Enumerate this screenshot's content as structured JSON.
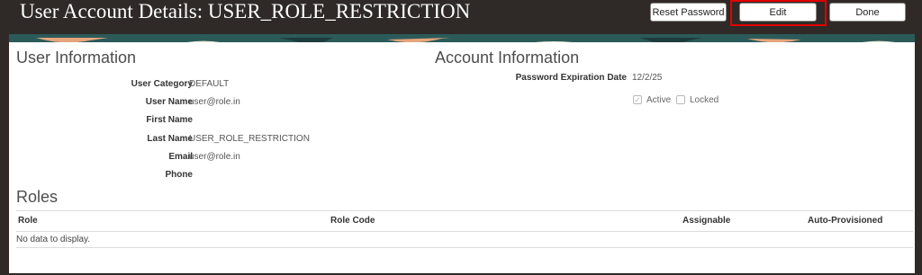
{
  "header": {
    "title": "User Account Details: USER_ROLE_RESTRICTION",
    "reset_password_label": "Reset Password",
    "edit_label": "Edit",
    "done_label": "Done"
  },
  "user_info": {
    "heading": "User Information",
    "fields": [
      {
        "label": "User Category",
        "value": "DEFAULT"
      },
      {
        "label": "User Name",
        "value": "user@role.in"
      },
      {
        "label": "First Name",
        "value": ""
      },
      {
        "label": "Last Name",
        "value": "USER_ROLE_RESTRICTION"
      },
      {
        "label": "Email",
        "value": "user@role.in"
      },
      {
        "label": "Phone",
        "value": ""
      }
    ]
  },
  "account_info": {
    "heading": "Account Information",
    "password_expiration_label": "Password Expiration Date",
    "password_expiration_value": "12/2/25",
    "active_label": "Active",
    "active_checked": true,
    "locked_label": "Locked",
    "locked_checked": false
  },
  "roles": {
    "heading": "Roles",
    "columns": [
      "Role",
      "Role Code",
      "Assignable",
      "Auto-Provisioned"
    ],
    "empty_message": "No data to display."
  },
  "colors": {
    "header_bg": "#2f2a27",
    "highlight": "#e00000",
    "banner_teal": "#2b5a59"
  }
}
